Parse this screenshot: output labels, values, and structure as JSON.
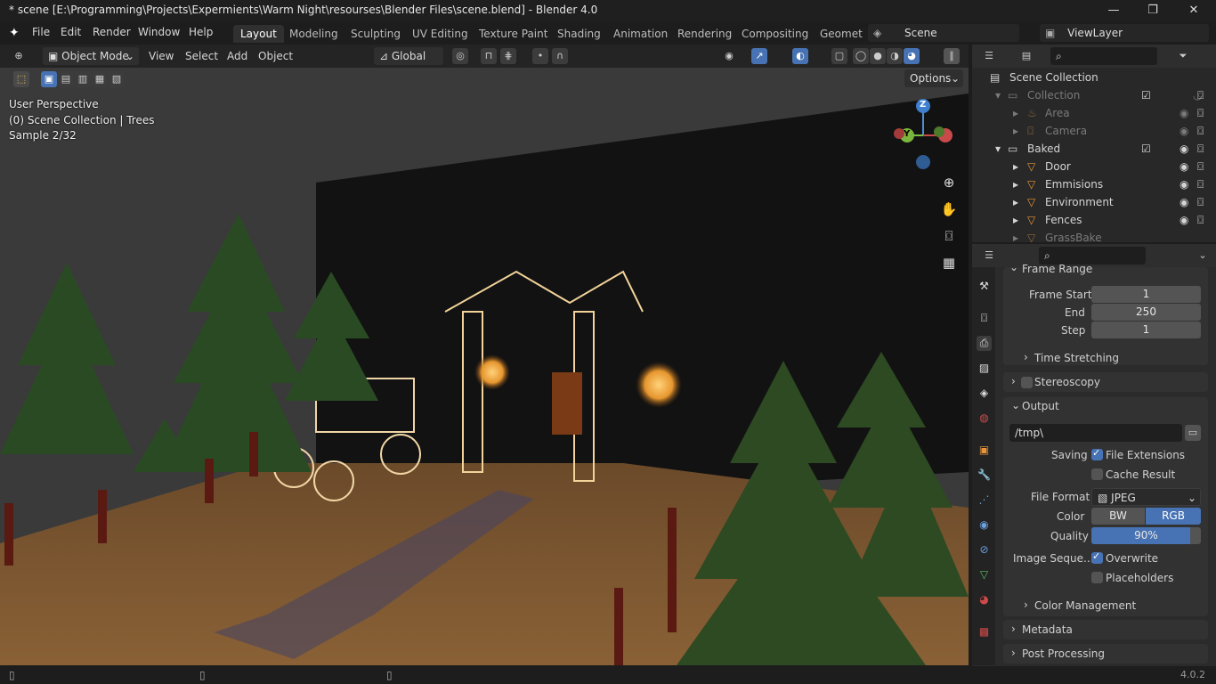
{
  "window": {
    "title": "* scene [E:\\Programming\\Projects\\Expermients\\Warm Night\\resourses\\Blender Files\\scene.blend] - Blender 4.0",
    "minimize": "—",
    "restore": "❐",
    "close": "✕"
  },
  "menu": {
    "items": [
      "File",
      "Edit",
      "Render",
      "Window",
      "Help"
    ],
    "workspaces": [
      "Layout",
      "Modeling",
      "Sculpting",
      "UV Editing",
      "Texture Paint",
      "Shading",
      "Animation",
      "Rendering",
      "Compositing",
      "Geomet"
    ],
    "scene_name": "Scene",
    "view_layer": "ViewLayer"
  },
  "viewport_header": {
    "mode": "Object Mode",
    "menus": [
      "View",
      "Select",
      "Add",
      "Object"
    ],
    "transform_orientation": "Global",
    "options_label": "Options"
  },
  "viewport_overlay": {
    "perspective": "User Perspective",
    "collection": "(0) Scene Collection | Trees",
    "sample": "Sample 2/32"
  },
  "gizmo": {
    "x": "X",
    "y": "Y",
    "z": "Z"
  },
  "outliner": {
    "root": "Scene Collection",
    "rows": [
      {
        "label": "Collection",
        "indent": 1,
        "dim": true
      },
      {
        "label": "Area",
        "indent": 2,
        "dim": true
      },
      {
        "label": "Camera",
        "indent": 2,
        "dim": true
      },
      {
        "label": "Baked",
        "indent": 1,
        "dim": false
      },
      {
        "label": "Door",
        "indent": 2,
        "dim": false
      },
      {
        "label": "Emmisions",
        "indent": 2,
        "dim": false
      },
      {
        "label": "Environment",
        "indent": 2,
        "dim": false
      },
      {
        "label": "Fences",
        "indent": 2,
        "dim": false
      },
      {
        "label": "GrassBake",
        "indent": 2,
        "dim": true
      }
    ]
  },
  "properties": {
    "frame_range_header": "Frame Range",
    "frame_start_label": "Frame Start",
    "frame_start": "1",
    "end_label": "End",
    "end": "250",
    "step_label": "Step",
    "step": "1",
    "time_stretching": "Time Stretching",
    "stereoscopy": "Stereoscopy",
    "output_header": "Output",
    "output_path": "/tmp\\",
    "saving_label": "Saving",
    "file_extensions": "File Extensions",
    "cache_result": "Cache Result",
    "file_format_label": "File Format",
    "file_format": "JPEG",
    "color_label": "Color",
    "color_bw": "BW",
    "color_rgb": "RGB",
    "quality_label": "Quality",
    "quality": "90%",
    "quality_fraction": 0.9,
    "image_sequence_label": "Image Seque...",
    "overwrite": "Overwrite",
    "placeholders": "Placeholders",
    "color_management": "Color Management",
    "metadata": "Metadata",
    "post_processing": "Post Processing"
  },
  "status": {
    "version": "4.0.2"
  },
  "colors": {
    "accent": "#4772b3",
    "bg": "#1d1d1d",
    "panel": "#323232"
  }
}
